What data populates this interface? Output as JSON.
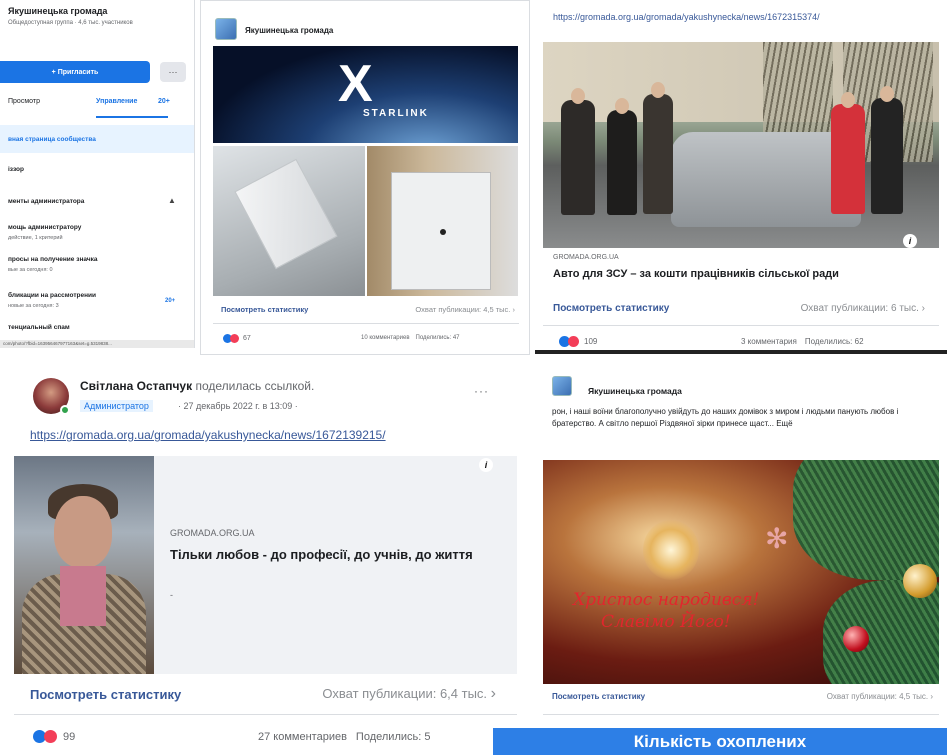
{
  "group_sidebar": {
    "title": "Якушинецька громада",
    "subtitle": "Общедоступная группа · 4,6 тыс. участников",
    "invite_label": "+ Пригласить",
    "more_label": "···",
    "tabs": [
      "Просмотр",
      "Управление",
      "20+"
    ],
    "items": [
      {
        "label": "вная страница сообщества",
        "sub": ""
      },
      {
        "label": "іззор",
        "sub": ""
      },
      {
        "label": "менты администратора",
        "sub": ""
      },
      {
        "label": "мощь администратору",
        "sub": "действие, 1 критерий"
      },
      {
        "label": "просы на получение значка",
        "sub": "вые за сегодня: 0"
      },
      {
        "label": "бликации на рассмотрении",
        "sub": "новые за сегодня: 3",
        "badge": "20+"
      },
      {
        "label": "тенциальный спам",
        "sub": ""
      }
    ],
    "chevron": "▲",
    "status_url": "com/photo/?fbid=163956467977163&set=g.5319838..."
  },
  "post_starlink": {
    "page_name": "Якушинецька громада",
    "brand_text": "STARLINK",
    "stats_link": "Посмотреть статистику",
    "reach": "Охват публикации: 4,5 тыс.",
    "reactions": "67",
    "comments": "10 комментариев",
    "shares": "Поделились: 47"
  },
  "post_car": {
    "url": "https://gromada.org.ua/gromada/yakushynecka/news/1672315374/",
    "domain": "GROMADA.ORG.UA",
    "headline": "Авто для ЗСУ – за кошти працівників сільської ради",
    "stats_link": "Посмотреть статистику",
    "reach": "Охват публикации: 6 тыс.",
    "reactions": "109",
    "comments": "3 комментария",
    "shares": "Поделились: 62"
  },
  "post_svitlana": {
    "author": "Світлана Остапчук",
    "action": "поделилась ссылкой.",
    "badge": "Администратор",
    "date": "· 27 декабрь 2022 г. в 13:09 ·",
    "more": "···",
    "url": "https://gromada.org.ua/gromada/yakushynecka/news/1672139215/",
    "domain": "GROMADA.ORG.UA",
    "headline": "Тільки любов - до професії, до учнів, до життя",
    "dot": "-",
    "stats_link": "Посмотреть статистику",
    "reach": "Охват публикации: 6,4 тыс.",
    "reactions": "99",
    "comments": "27 комментариев",
    "shares": "Поделились: 5"
  },
  "post_xmas": {
    "page_name": "Якушинецька громада",
    "text": "рон, і наші воїни благополучно увійдуть до наших домівок з миром і людьми панують любов і братерство. А світло першої Різдвяної зірки принесе щаст... Ещё",
    "greeting_line1": "Христос народився!",
    "greeting_line2": "Славімо Його!",
    "stats_link": "Посмотреть статистику",
    "reach": "Охват публикации: 4,5 тыс."
  },
  "banner": {
    "text": "Кількість охоплених"
  },
  "colors": {
    "fb_blue": "#1b74e4",
    "link": "#385898",
    "love_red": "#f33e58",
    "banner_blue": "#2d7fe6"
  }
}
